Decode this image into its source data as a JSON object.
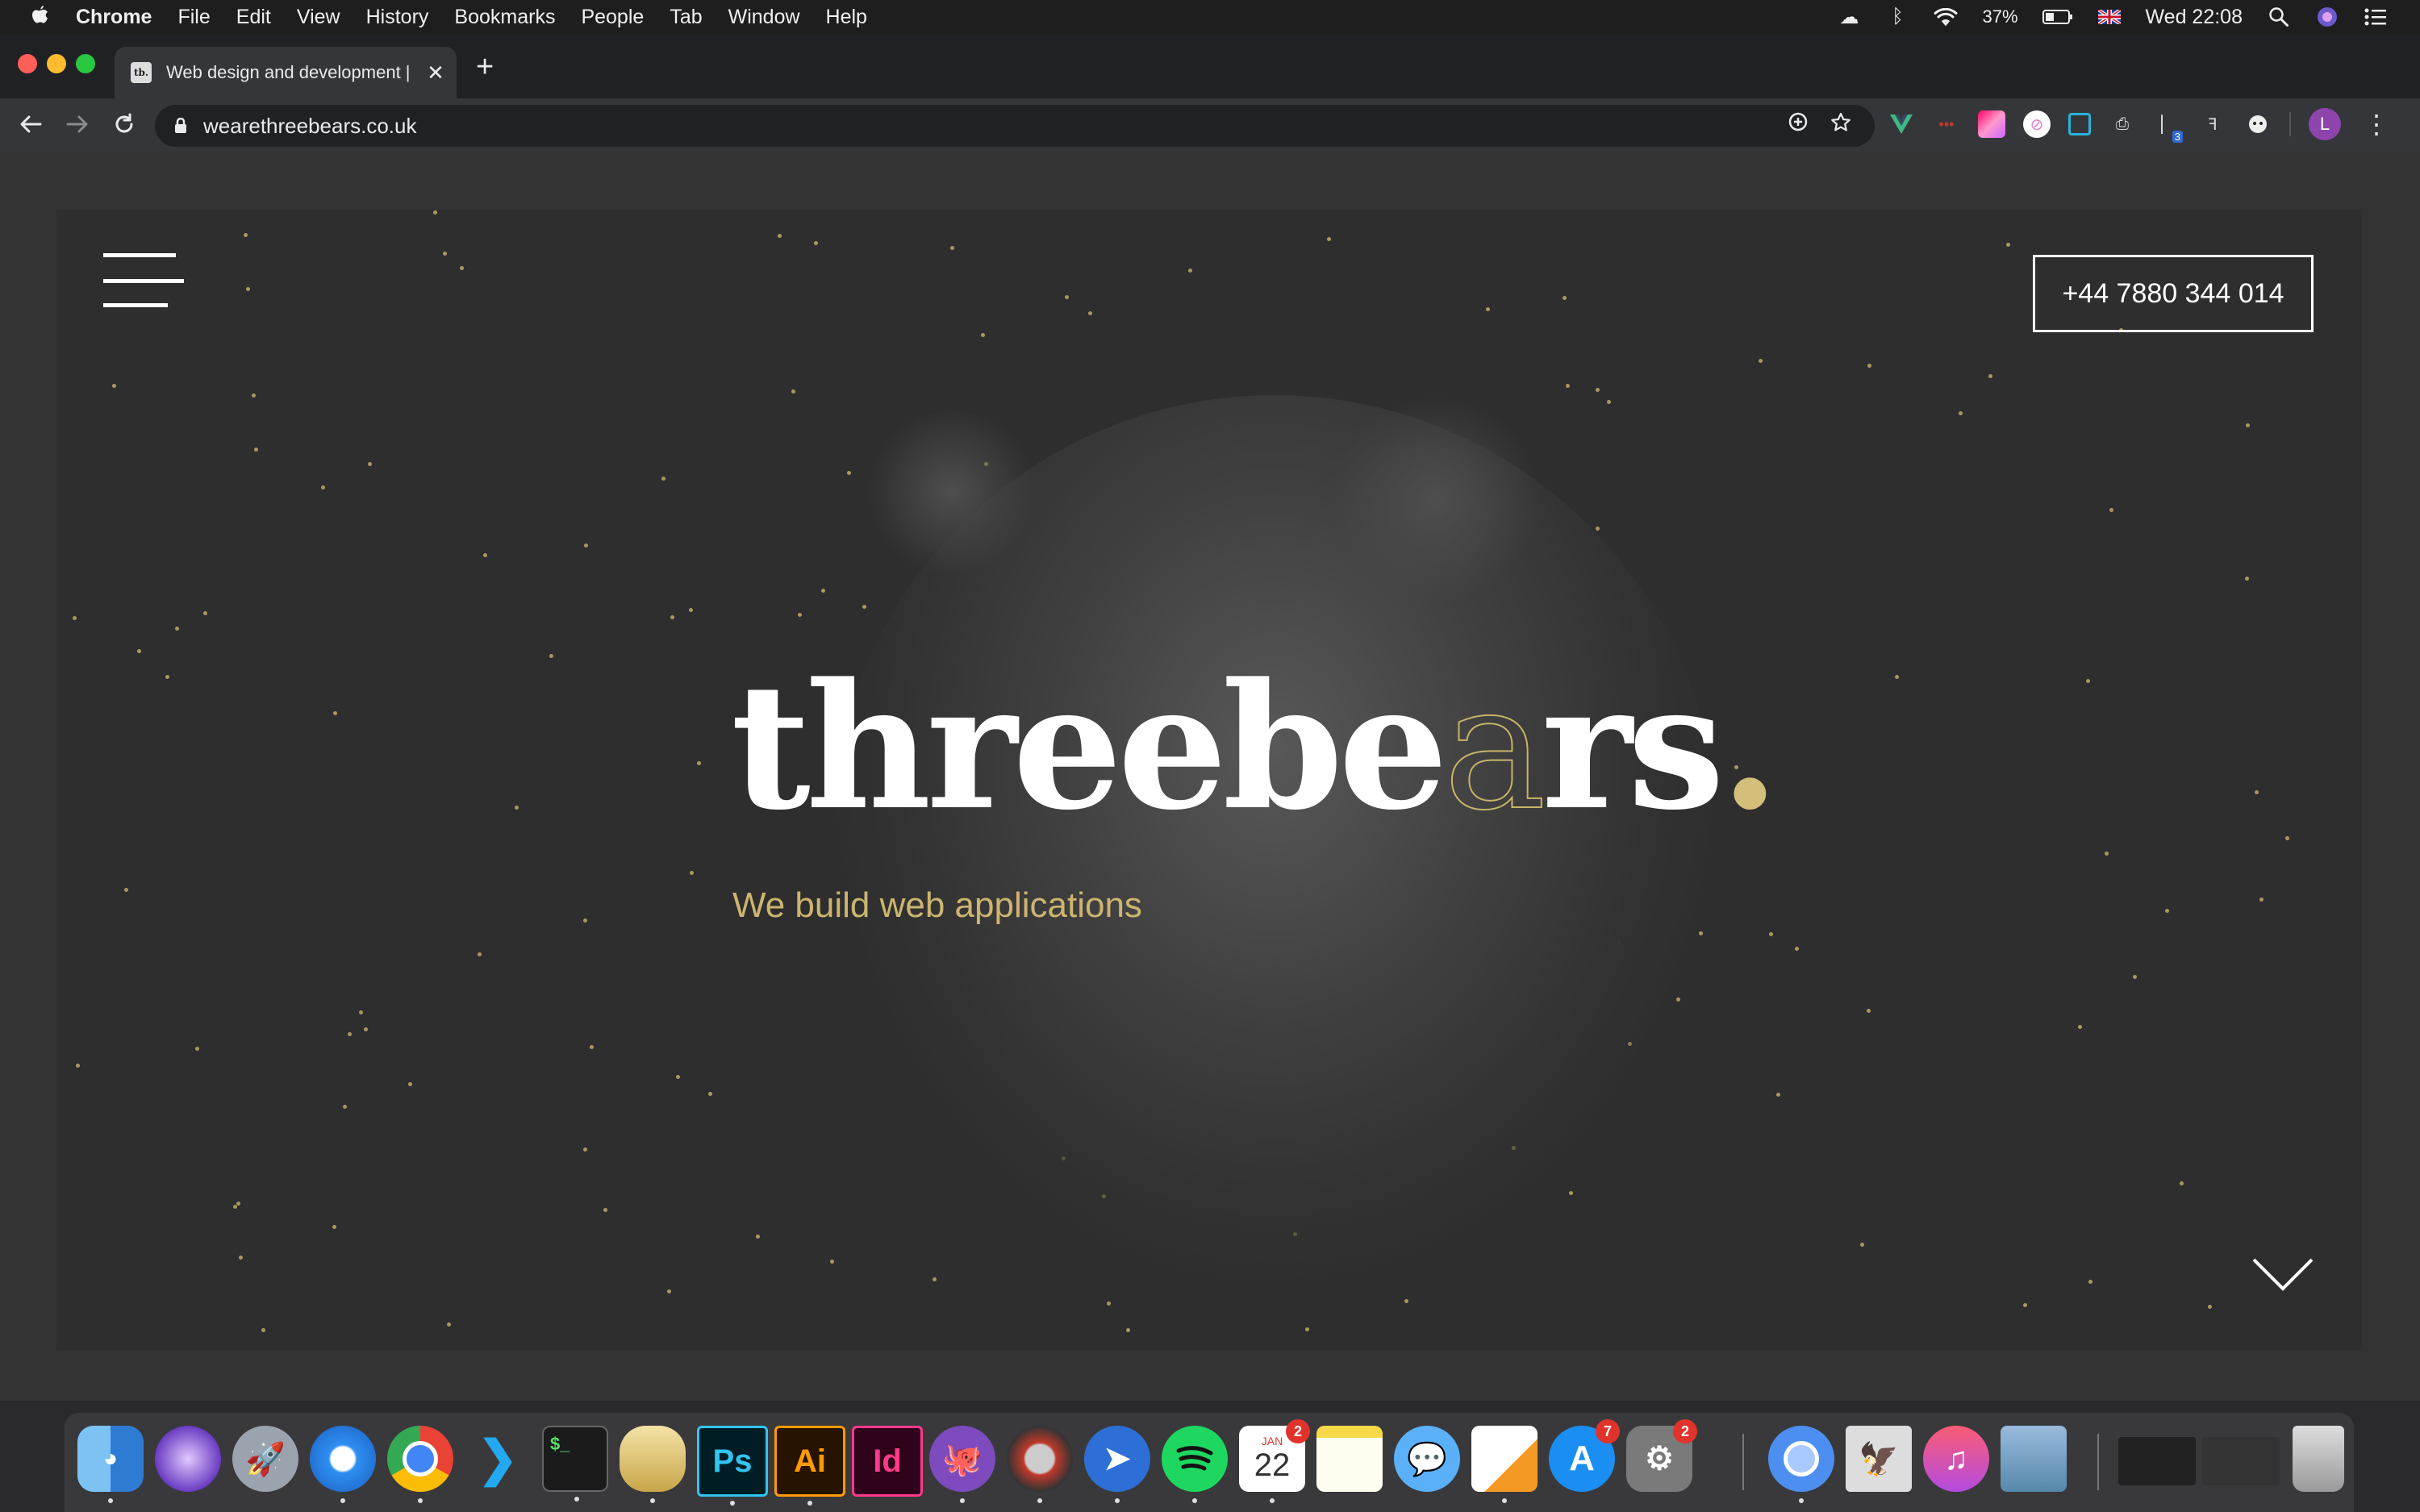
{
  "menubar": {
    "app_name": "Chrome",
    "items": [
      "File",
      "Edit",
      "View",
      "History",
      "Bookmarks",
      "People",
      "Tab",
      "Window",
      "Help"
    ],
    "battery": "37%",
    "clock": "Wed 22:08"
  },
  "browser": {
    "tab_title": "Web design and development |",
    "tab_favicon_text": "tb.",
    "url": "wearethreebears.co.uk",
    "profile_initial": "L",
    "extension_badge": "3"
  },
  "hero": {
    "phone": "+44 7880 344 014",
    "brand_part1": "threebe",
    "brand_ghost": "a",
    "brand_part2": "rs",
    "brand_dot": ".",
    "tagline": "We build web applications"
  },
  "dock": {
    "calendar_month": "JAN",
    "calendar_day": "22",
    "badges": {
      "calendar": "2",
      "app_store": "7",
      "system_prefs": "2"
    },
    "icons": [
      "finder-icon",
      "siri-icon",
      "launchpad-icon",
      "safari-icon",
      "chrome-icon",
      "vscode-icon",
      "terminal-icon",
      "sequel-pro-icon",
      "photoshop-icon",
      "illustrator-icon",
      "indesign-icon",
      "github-desktop-icon",
      "time-machine-icon",
      "spark-icon",
      "spotify-icon",
      "calendar-icon",
      "notes-icon",
      "messages-icon",
      "pages-icon",
      "app-store-icon",
      "system-preferences-icon",
      "chromium-icon",
      "preview-icon",
      "itunes-icon",
      "image-viewer-icon",
      "window-thumbnail-icon",
      "window-thumbnail-icon",
      "trash-icon"
    ],
    "labels": {
      "photoshop": "Ps",
      "illustrator": "Ai",
      "indesign": "Id",
      "terminal": "$_"
    }
  }
}
